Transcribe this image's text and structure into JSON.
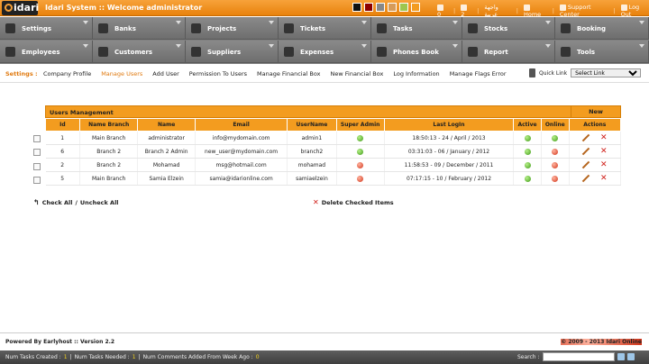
{
  "app": {
    "logo": "idari",
    "title": "Idari System :: Welcome administrator"
  },
  "swatches": [
    "#111111",
    "#8b0000",
    "#888888",
    "#d69b5a",
    "#9ec64e",
    "#f39c1f"
  ],
  "toplinks": {
    "messages": "0",
    "tasks": "2",
    "language": "واجهة عربية",
    "home": "Home",
    "support": "Support Center",
    "logout": "Log Out"
  },
  "menu": [
    {
      "label": "Settings",
      "icon": "wrench-icon"
    },
    {
      "label": "Banks",
      "icon": "bank-icon"
    },
    {
      "label": "Projects",
      "icon": "projects-icon"
    },
    {
      "label": "Tickets",
      "icon": "ticket-icon"
    },
    {
      "label": "Tasks",
      "icon": "tasks-icon"
    },
    {
      "label": "Stocks",
      "icon": "truck-icon"
    },
    {
      "label": "Booking",
      "icon": "booking-icon"
    },
    {
      "label": "Employees",
      "icon": "employees-icon"
    },
    {
      "label": "Customers",
      "icon": "customers-icon"
    },
    {
      "label": "Suppliers",
      "icon": "suppliers-icon"
    },
    {
      "label": "Expenses",
      "icon": "briefcase-icon"
    },
    {
      "label": "Phones Book",
      "icon": "phonebook-icon"
    },
    {
      "label": "Report",
      "icon": "report-icon"
    },
    {
      "label": "Tools",
      "icon": "gear-icon"
    }
  ],
  "subnav": {
    "title": "Settings :",
    "links": [
      "Company Profile",
      "Manage Users",
      "Add User",
      "Permission To Users",
      "Manage Financial Box",
      "New Financial Box",
      "Log Information",
      "Manage Flags Error"
    ],
    "active_index": 1,
    "quick_link_label": "Quick Link",
    "quick_link_value": "Select Link"
  },
  "panel": {
    "title": "Users Management",
    "new_label": "New"
  },
  "columns": [
    "Id",
    "Name Branch",
    "Name",
    "Email",
    "UserName",
    "Super Admin",
    "Last LogIn",
    "Active",
    "Online",
    "Actions"
  ],
  "rows": [
    {
      "id": "1",
      "branch": "Main Branch",
      "name": "administrator",
      "email": "info@mydomain.com",
      "username": "admin1",
      "super": "yes",
      "last": "18:50:13 - 24 / April / 2013",
      "active": "yes",
      "online": "yes"
    },
    {
      "id": "6",
      "branch": "Branch 2",
      "name": "Branch 2 Admin",
      "email": "new_user@mydomain.com",
      "username": "branch2",
      "super": "yes",
      "last": "03:31:03 - 06 / January / 2012",
      "active": "yes",
      "online": "no"
    },
    {
      "id": "2",
      "branch": "Branch 2",
      "name": "Mohamad",
      "email": "msg@hotmail.com",
      "username": "mohamad",
      "super": "no",
      "last": "11:58:53 - 09 / December / 2011",
      "active": "yes",
      "online": "no"
    },
    {
      "id": "5",
      "branch": "Main Branch",
      "name": "Samia Elzein",
      "email": "samia@idarionline.com",
      "username": "samiaelzein",
      "super": "no",
      "last": "07:17:15 - 10 / February / 2012",
      "active": "yes",
      "online": "no"
    }
  ],
  "actions": {
    "check_all": "Check All",
    "uncheck_all": "Uncheck All",
    "delete_checked": "Delete Checked Items"
  },
  "footer": {
    "left": "Powered By Earlyhost :: Version 2.2",
    "right": "© 2009 - 2013 Idari Online"
  },
  "statusbar": {
    "tasks_created": "Num Tasks Created :",
    "tasks_created_val": "1",
    "tasks_needed": "Num Tasks Needed :",
    "tasks_needed_val": "1",
    "comments": "Num Comments Added From Week Ago :",
    "comments_val": "0",
    "search_label": "Search :"
  }
}
